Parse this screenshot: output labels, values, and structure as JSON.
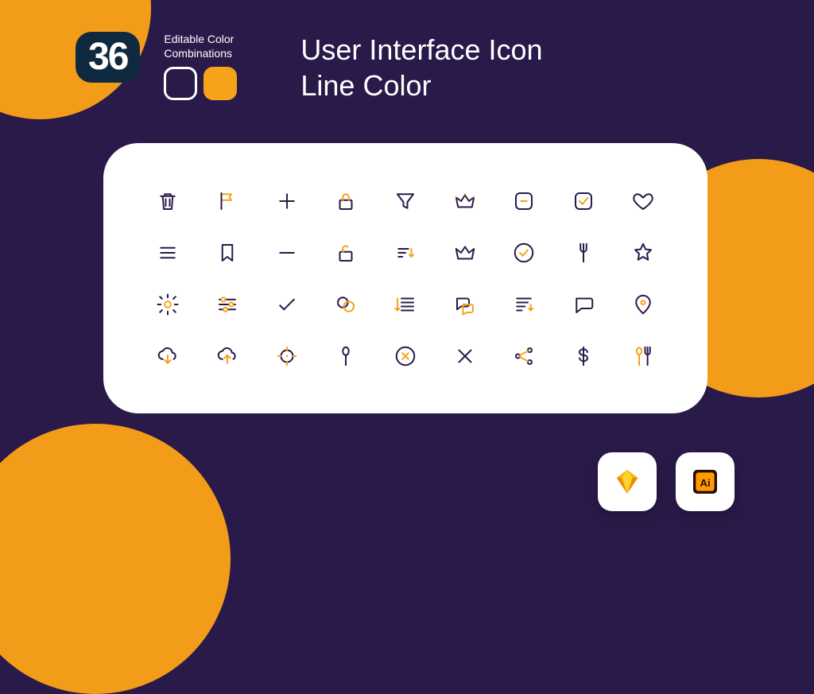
{
  "badge_number": "36",
  "editable_line1": "Editable Color",
  "editable_line2": "Combinations",
  "title_line1": "User Interface Icon",
  "title_line2": "Line Color",
  "colors": {
    "accent": "#f6a21b",
    "dark": "#2a1a4a",
    "bg": "#2a1a4a"
  },
  "icons": [
    "trash",
    "flag",
    "plus",
    "lock",
    "funnel",
    "crown",
    "minus-square",
    "check-square",
    "heart",
    "menu",
    "bookmark",
    "minus",
    "unlock",
    "sort-down",
    "crown-outline",
    "check-circle",
    "fork",
    "star",
    "settings",
    "sliders",
    "check",
    "chat-bubbles",
    "list-down",
    "comments",
    "text-down",
    "speech",
    "location",
    "cloud-download",
    "cloud-upload",
    "target",
    "spoon",
    "x-circle",
    "x",
    "share",
    "dollar",
    "utensils"
  ],
  "apps": [
    "sketch",
    "illustrator"
  ]
}
